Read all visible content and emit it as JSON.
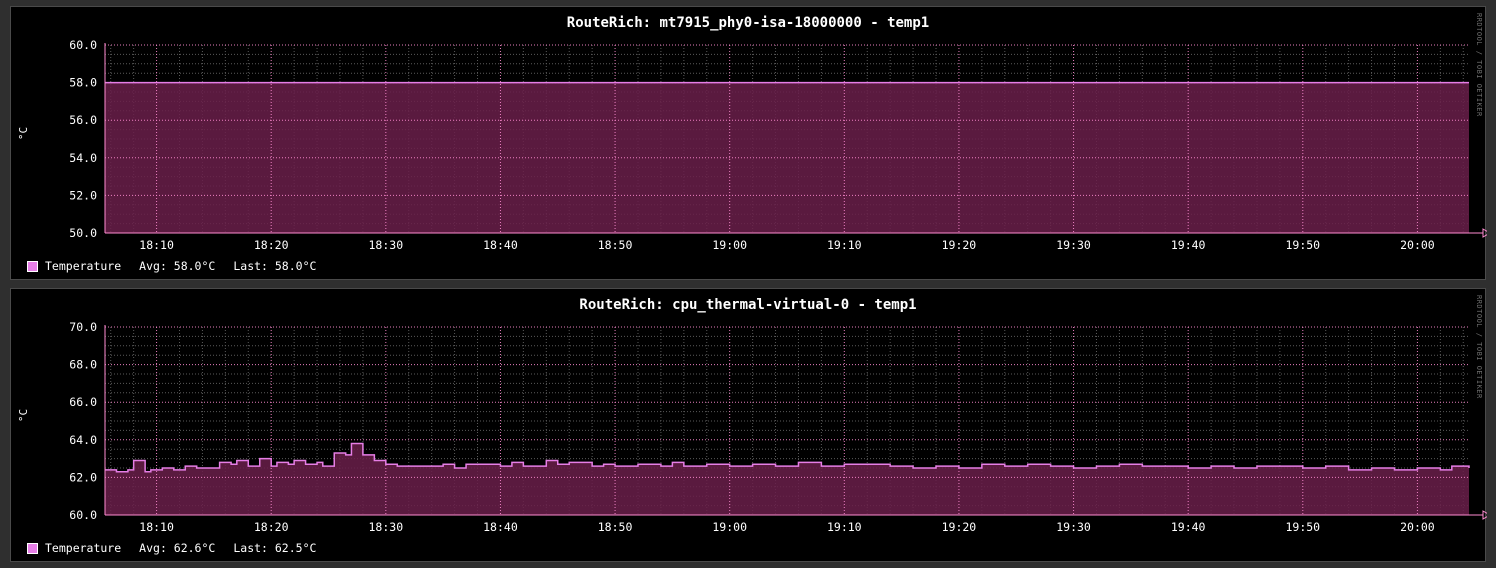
{
  "graphs": [
    {
      "title": "RouteRich: mt7915_phy0-isa-18000000 - temp1",
      "ylabel": "°C",
      "watermark": "RRDTOOL / TOBI OETIKER",
      "legend": {
        "name": "Temperature",
        "avg": "Avg: 58.0°C",
        "last": "Last: 58.0°C"
      }
    },
    {
      "title": "RouteRich: cpu_thermal-virtual-0 - temp1",
      "ylabel": "°C",
      "watermark": "RRDTOOL / TOBI OETIKER",
      "legend": {
        "name": "Temperature",
        "avg": "Avg: 62.6°C",
        "last": "Last: 62.5°C"
      }
    }
  ],
  "colors": {
    "line": "#e67ee6",
    "fill": "#6a1e4a",
    "grid_major": "#ff8cd2",
    "grid_minor": "#5a5a5a",
    "axis": "#ff8cd2"
  },
  "chart_data": [
    {
      "type": "area",
      "title": "RouteRich: mt7915_phy0-isa-18000000 - temp1",
      "ylabel": "°C",
      "ylim": [
        50,
        60
      ],
      "yticks": [
        "60.0",
        "58.0",
        "56.0",
        "54.0",
        "52.0",
        "50.0"
      ],
      "xticks": [
        "18:10",
        "18:20",
        "18:30",
        "18:40",
        "18:50",
        "19:00",
        "19:10",
        "19:20",
        "19:30",
        "19:40",
        "19:50",
        "20:00"
      ],
      "xlim_minutes": [
        1085.5,
        1204.5
      ],
      "series": [
        {
          "name": "Temperature",
          "x": [
            1085.5,
            1204.5
          ],
          "y": [
            58.0,
            58.0
          ]
        }
      ]
    },
    {
      "type": "area",
      "title": "RouteRich: cpu_thermal-virtual-0 - temp1",
      "ylabel": "°C",
      "ylim": [
        60,
        70
      ],
      "yticks": [
        "70.0",
        "68.0",
        "66.0",
        "64.0",
        "62.0",
        "60.0"
      ],
      "xticks": [
        "18:10",
        "18:20",
        "18:30",
        "18:40",
        "18:50",
        "19:00",
        "19:10",
        "19:20",
        "19:30",
        "19:40",
        "19:50",
        "20:00"
      ],
      "xlim_minutes": [
        1085.5,
        1204.5
      ],
      "series": [
        {
          "name": "Temperature",
          "x": [
            1085.5,
            1086.5,
            1087.5,
            1088,
            1089,
            1089.5,
            1090.5,
            1091.5,
            1092.5,
            1093.5,
            1094.5,
            1095.5,
            1096.5,
            1097,
            1098,
            1099,
            1100,
            1100.5,
            1101.5,
            1102,
            1103,
            1104,
            1104.5,
            1105.5,
            1106.5,
            1107,
            1108,
            1109,
            1110,
            1111,
            1112,
            1113,
            1114,
            1115,
            1116,
            1117,
            1118,
            1120,
            1121,
            1122,
            1124,
            1125,
            1126,
            1128,
            1129,
            1130,
            1132,
            1134,
            1135,
            1136,
            1138,
            1140,
            1141,
            1142,
            1144,
            1146,
            1148,
            1150,
            1152,
            1154,
            1156,
            1158,
            1160,
            1162,
            1164,
            1166,
            1168,
            1170,
            1172,
            1174,
            1176,
            1178,
            1180,
            1182,
            1184,
            1186,
            1188,
            1190,
            1192,
            1194,
            1196,
            1198,
            1200,
            1202,
            1203,
            1204.5
          ],
          "y": [
            62.4,
            62.3,
            62.4,
            62.9,
            62.3,
            62.4,
            62.5,
            62.4,
            62.6,
            62.5,
            62.5,
            62.8,
            62.7,
            62.9,
            62.6,
            63.0,
            62.6,
            62.8,
            62.7,
            62.9,
            62.7,
            62.8,
            62.6,
            63.3,
            63.2,
            63.8,
            63.2,
            62.9,
            62.7,
            62.6,
            62.6,
            62.6,
            62.6,
            62.7,
            62.5,
            62.7,
            62.7,
            62.6,
            62.8,
            62.6,
            62.9,
            62.7,
            62.8,
            62.6,
            62.7,
            62.6,
            62.7,
            62.6,
            62.8,
            62.6,
            62.7,
            62.6,
            62.6,
            62.7,
            62.6,
            62.8,
            62.6,
            62.7,
            62.7,
            62.6,
            62.5,
            62.6,
            62.5,
            62.7,
            62.6,
            62.7,
            62.6,
            62.5,
            62.6,
            62.7,
            62.6,
            62.6,
            62.5,
            62.6,
            62.5,
            62.6,
            62.6,
            62.5,
            62.6,
            62.4,
            62.5,
            62.4,
            62.5,
            62.4,
            62.6,
            62.5
          ]
        }
      ]
    }
  ]
}
